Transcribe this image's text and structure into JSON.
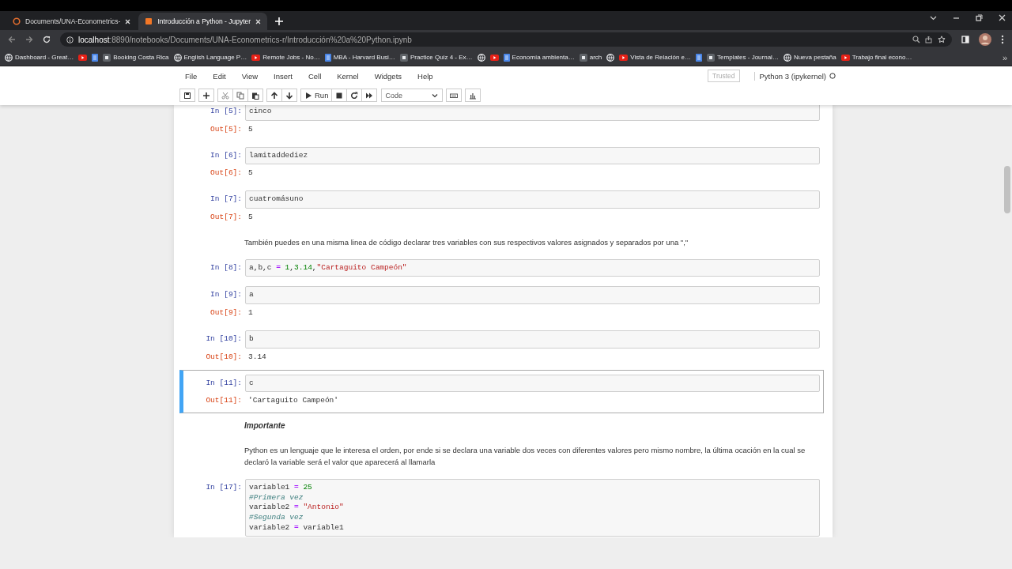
{
  "browser": {
    "tabs": [
      {
        "title": "Documents/UNA-Econometrics-",
        "selected": false
      },
      {
        "title": "Introducción a Python - Jupyter",
        "selected": true
      }
    ],
    "url": {
      "host": "localhost",
      "path": ":8890/notebooks/Documents/UNA-Econometrics-r/Introducción%20a%20Python.ipynb"
    },
    "bookmarks": [
      {
        "kind": "link",
        "label": "Dashboard - Great…"
      },
      {
        "kind": "icon"
      },
      {
        "kind": "icon"
      },
      {
        "kind": "link",
        "label": "Booking Costa Rica"
      },
      {
        "kind": "link",
        "label": "English Language P…"
      },
      {
        "kind": "link",
        "label": "Remote Jobs - No…"
      },
      {
        "kind": "link",
        "label": "MBA - Harvard Busi…"
      },
      {
        "kind": "link",
        "label": "Practice Quiz 4 - Ex…"
      },
      {
        "kind": "icon"
      },
      {
        "kind": "icon"
      },
      {
        "kind": "link",
        "label": "Economía ambienta…"
      },
      {
        "kind": "link",
        "label": "arch"
      },
      {
        "kind": "icon"
      },
      {
        "kind": "link",
        "label": "Vista de Relación e…"
      },
      {
        "kind": "icon"
      },
      {
        "kind": "link",
        "label": "Templates - Journal…"
      },
      {
        "kind": "link",
        "label": "Nueva pestaña"
      },
      {
        "kind": "link",
        "label": "Trabajo final econo…"
      }
    ],
    "more": "»"
  },
  "jupyter": {
    "menu": [
      "File",
      "Edit",
      "View",
      "Insert",
      "Cell",
      "Kernel",
      "Widgets",
      "Help"
    ],
    "trusted": "Trusted",
    "kernel": "Python 3 (ipykernel)",
    "run": "Run",
    "cell_type": "Code"
  },
  "cells": [
    {
      "kind": "code",
      "selected": false,
      "prompt": "In [5]:",
      "lines": [
        [
          {
            "kind": "name",
            "t": "cinco"
          }
        ]
      ],
      "out_prompt": "Out[5]:",
      "output": "5"
    },
    {
      "kind": "code",
      "selected": false,
      "prompt": "In [6]:",
      "lines": [
        [
          {
            "kind": "name",
            "t": "lamitaddediez"
          }
        ]
      ],
      "out_prompt": "Out[6]:",
      "output": "5"
    },
    {
      "kind": "code",
      "selected": false,
      "prompt": "In [7]:",
      "lines": [
        [
          {
            "kind": "name",
            "t": "cuatromásuno"
          }
        ]
      ],
      "out_prompt": "Out[7]:",
      "output": "5"
    },
    {
      "kind": "text",
      "text": "También puedes en una misma linea de código declarar tres variables con sus respectivos valores asignados y separados por una \",\""
    },
    {
      "kind": "code",
      "selected": false,
      "prompt": "In [8]:",
      "lines": [
        [
          {
            "kind": "name",
            "t": "a,b,c "
          },
          {
            "kind": "op",
            "t": "="
          },
          {
            "kind": "number",
            "t": " 1"
          },
          {
            "kind": "name",
            "t": ","
          },
          {
            "kind": "number",
            "t": "3.14"
          },
          {
            "kind": "name",
            "t": ","
          },
          {
            "kind": "string",
            "t": "\"Cartaguito Campeón\""
          }
        ]
      ]
    },
    {
      "kind": "code",
      "selected": false,
      "prompt": "In [9]:",
      "lines": [
        [
          {
            "kind": "name",
            "t": "a"
          }
        ]
      ],
      "out_prompt": "Out[9]:",
      "output": "1"
    },
    {
      "kind": "code",
      "selected": false,
      "prompt": "In [10]:",
      "lines": [
        [
          {
            "kind": "name",
            "t": "b"
          }
        ]
      ],
      "out_prompt": "Out[10]:",
      "output": "3.14"
    },
    {
      "kind": "code",
      "selected": true,
      "prompt": "In [11]:",
      "lines": [
        [
          {
            "kind": "name",
            "t": "c"
          }
        ]
      ],
      "out_prompt": "Out[11]:",
      "output": "'Cartaguito Campeón'"
    },
    {
      "kind": "heading",
      "text": "Importante"
    },
    {
      "kind": "text",
      "text": "Python es un lenguaje que le interesa el orden, por ende si se declara una variable dos veces con diferentes valores pero mismo nombre, la última ocación en la cual se declaró la variable será el valor que aparecerá al llamarla"
    },
    {
      "kind": "code",
      "selected": false,
      "prompt": "In [17]:",
      "lines": [
        [
          {
            "kind": "name",
            "t": "variable1 "
          },
          {
            "kind": "op",
            "t": "="
          },
          {
            "kind": "number",
            "t": " 25"
          }
        ],
        [
          {
            "kind": "comment",
            "t": "#Primera vez"
          }
        ],
        [
          {
            "kind": "name",
            "t": "variable2 "
          },
          {
            "kind": "op",
            "t": "="
          },
          {
            "kind": "string",
            "t": " \"Antonio\""
          }
        ],
        [
          {
            "kind": "comment",
            "t": "#Segunda vez"
          }
        ],
        [
          {
            "kind": "name",
            "t": "variable2 "
          },
          {
            "kind": "op",
            "t": "="
          },
          {
            "kind": "name",
            "t": " variable1"
          }
        ]
      ]
    }
  ]
}
